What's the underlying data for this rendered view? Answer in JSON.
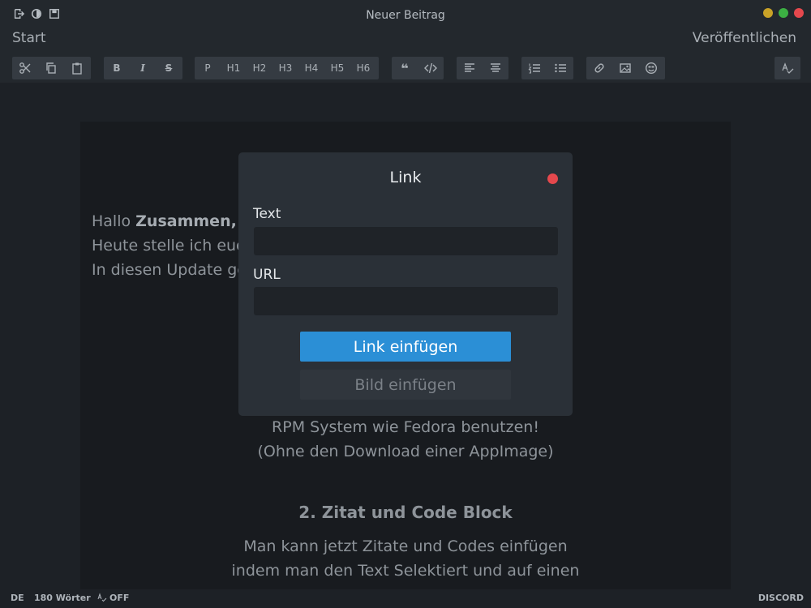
{
  "window": {
    "title": "Neuer Beitrag",
    "icons": [
      "exit-icon",
      "brightness-icon",
      "save-icon"
    ],
    "lights": [
      "#c9a227",
      "#3cb043",
      "#e5484d"
    ]
  },
  "nav": {
    "start": "Start",
    "publish": "Veröffentlichen"
  },
  "toolbar": {
    "headings": [
      "P",
      "H1",
      "H2",
      "H3",
      "H4",
      "H5",
      "H6"
    ]
  },
  "document": {
    "greeting_prefix": "Hallo ",
    "greeting_bold": "Zusammen,",
    "line2": "Heute stelle ich euc",
    "line3": "In diesen Update ge",
    "line4": "RPM System wie Fedora benutzen!",
    "line5": "(Ohne den Download einer AppImage)",
    "heading2": "2. Zitat und Code Block",
    "line6": "Man kann jetzt Zitate und Codes einfügen",
    "line7": "indem man den Text Selektiert und auf einen"
  },
  "modal": {
    "title": "Link",
    "text_label": "Text",
    "text_value": "",
    "url_label": "URL",
    "url_value": "",
    "insert_link": "Link einfügen",
    "insert_image": "Bild einfügen"
  },
  "status": {
    "language": "DE",
    "words": "180 Wörter",
    "spellcheck": "OFF",
    "discord": "DISCORD"
  },
  "colors": {
    "accent": "#2b8fd6",
    "close": "#e5484d"
  }
}
